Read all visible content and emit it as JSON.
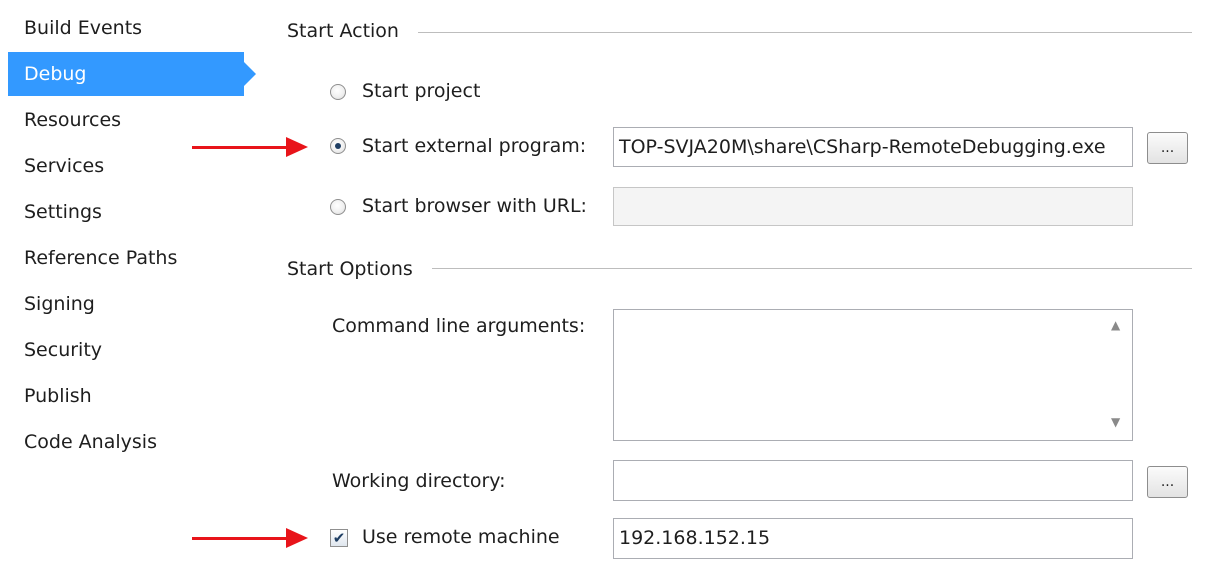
{
  "sidebar": {
    "items": [
      {
        "label": "Build Events",
        "active": false
      },
      {
        "label": "Debug",
        "active": true
      },
      {
        "label": "Resources",
        "active": false
      },
      {
        "label": "Services",
        "active": false
      },
      {
        "label": "Settings",
        "active": false
      },
      {
        "label": "Reference Paths",
        "active": false
      },
      {
        "label": "Signing",
        "active": false
      },
      {
        "label": "Security",
        "active": false
      },
      {
        "label": "Publish",
        "active": false
      },
      {
        "label": "Code Analysis",
        "active": false
      }
    ]
  },
  "start_action": {
    "title": "Start Action",
    "start_project": {
      "label": "Start project",
      "selected": false
    },
    "start_external": {
      "label": "Start external program:",
      "selected": true,
      "value": "TOP-SVJA20M\\share\\CSharp-RemoteDebugging.exe"
    },
    "start_browser": {
      "label": "Start browser with URL:",
      "selected": false,
      "value": ""
    },
    "browse_label": "..."
  },
  "start_options": {
    "title": "Start Options",
    "command_line": {
      "label": "Command line arguments:",
      "value": ""
    },
    "working_directory": {
      "label": "Working directory:",
      "value": ""
    },
    "remote_machine": {
      "label": "Use remote machine",
      "checked": true,
      "value": "192.168.152.15"
    },
    "browse_label": "..."
  },
  "colors": {
    "accent": "#3399ff",
    "annotation_arrow": "#e8141a"
  }
}
